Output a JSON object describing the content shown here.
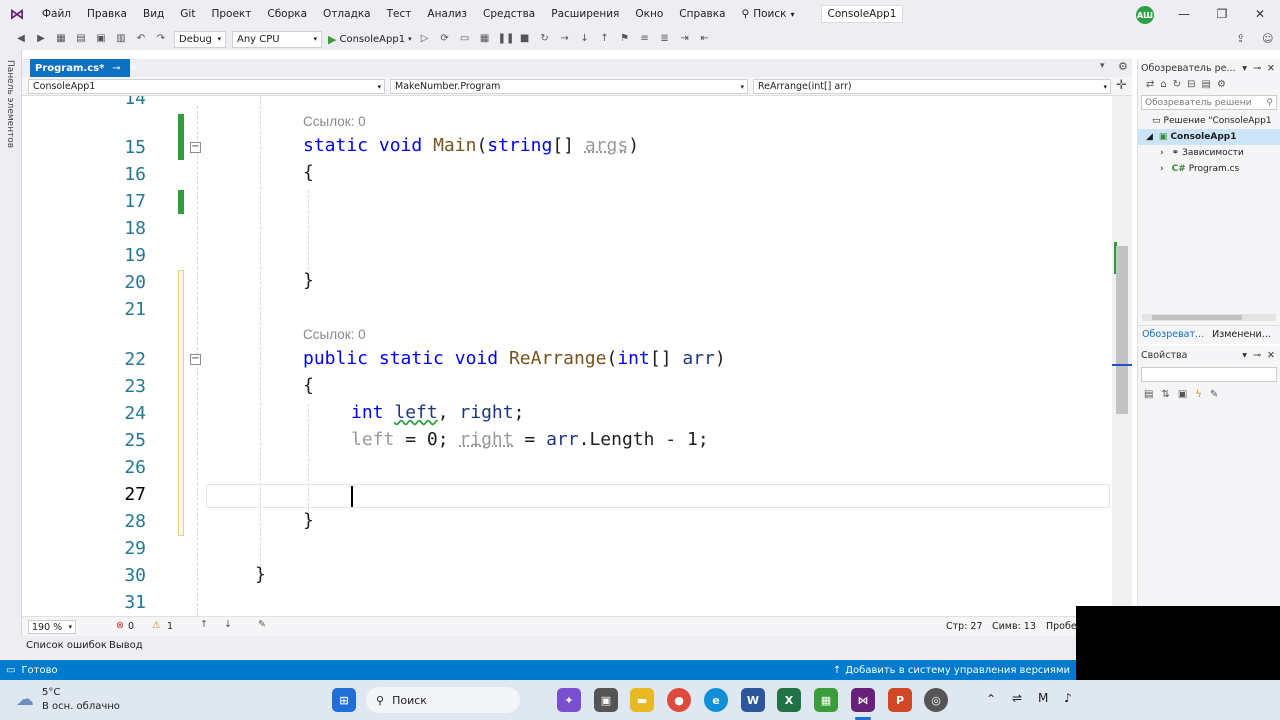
{
  "menu": {
    "items": [
      "Файл",
      "Правка",
      "Вид",
      "Git",
      "Проект",
      "Сборка",
      "Отладка",
      "Тест",
      "Анализ",
      "Средства",
      "Расширения",
      "Окно",
      "Справка"
    ],
    "search_label": "Поиск",
    "solution_title": "ConsoleApp1",
    "avatar_initials": "АШ"
  },
  "toolbar": {
    "config": "Debug",
    "platform": "Any CPU",
    "run_target": "ConsoleApp1"
  },
  "left_strip": {
    "label": "Панель элементов"
  },
  "tabs": [
    {
      "label": "Program.cs*"
    }
  ],
  "navbar": {
    "project": "ConsoleApp1",
    "class": "MakeNumber.Program",
    "member": "ReArrange(int[] arr)"
  },
  "editor": {
    "references_label": "Ссылок: 0",
    "line_numbers": [
      "14",
      "15",
      "16",
      "17",
      "18",
      "19",
      "20",
      "21",
      "22",
      "23",
      "24",
      "25",
      "26",
      "27",
      "28",
      "29",
      "30",
      "31"
    ],
    "current_line": "27"
  },
  "editor_status": {
    "zoom": "190 %",
    "errors": "0",
    "warnings": "1",
    "line": "Стр: 27",
    "col": "Симв: 13",
    "spaces": "Пробел"
  },
  "bottom_tabs": [
    "Список ошибок",
    "Вывод"
  ],
  "statusbar": {
    "ready": "Готово",
    "vcs": "Добавить в систему управления версиями"
  },
  "solution_explorer": {
    "title": "Обозреватель ре...",
    "search_placeholder": "Обозреватель решени",
    "solution": "Решение \"ConsoleApp1",
    "project": "ConsoleApp1",
    "deps": "Зависимости",
    "file": "Program.cs",
    "tab1": "Обозреват...",
    "tab2": "Изменени..."
  },
  "properties": {
    "title": "Свойства"
  },
  "taskbar": {
    "temp": "5°C",
    "weather": "В осн. облачно",
    "search": "Поиск"
  },
  "colors": {
    "accent": "#007acc",
    "keyword": "#0000ff",
    "method": "#74531f",
    "line_number": "#237893"
  }
}
